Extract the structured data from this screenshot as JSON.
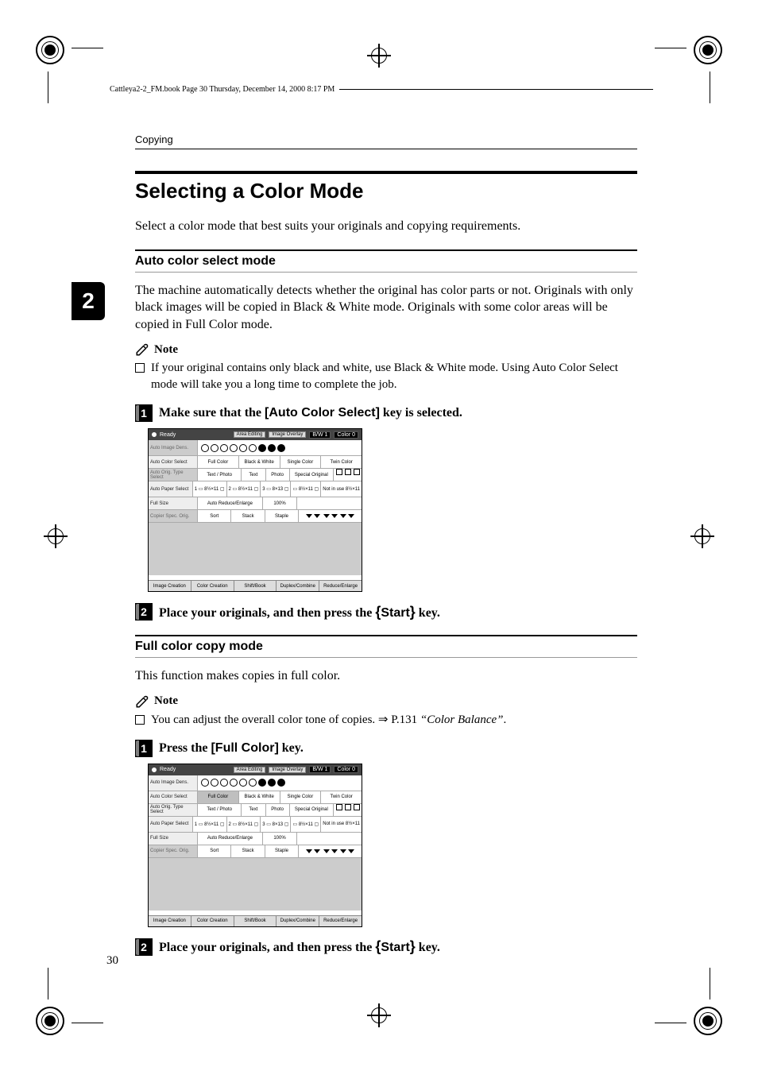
{
  "bookpath": "Cattleya2-2_FM.book  Page 30  Thursday, December 14, 2000  8:17 PM",
  "runhead": "Copying",
  "chapter_tab": "2",
  "page_number": "30",
  "h2": "Selecting a Color Mode",
  "intro": "Select a color mode that best suits your originals and copying requirements.",
  "sections": {
    "auto": {
      "h3": "Auto color select mode",
      "para": "The machine automatically detects whether the original has color parts or not. Originals with only black images will be copied in Black & White mode. Originals with some color areas will be copied in Full Color mode.",
      "note_label": "Note",
      "note_item": "If your original contains only black and white, use Black & White mode. Using Auto Color Select mode will take you a long time to complete the job.",
      "step1_pre": "Make sure that the ",
      "step1_key": "[Auto Color Select]",
      "step1_post": " key is selected.",
      "step2_pre": "Place your originals, and then press the ",
      "step2_key": "Start",
      "step2_post": " key."
    },
    "full": {
      "h3": "Full color copy mode",
      "para": "This function makes copies in full color.",
      "note_label": "Note",
      "note_item_pre": "You can adjust the overall color tone of copies. ⇒ P.131 ",
      "note_item_ref": "“Color Balance”",
      "note_item_post": ".",
      "step1_pre": "Press the ",
      "step1_key": "[Full Color]",
      "step1_post": " key.",
      "step2_pre": "Place your originals, and then press the ",
      "step2_key": "Start",
      "step2_post": " key."
    }
  },
  "panel": {
    "ready": "Ready",
    "top_chips": [
      "Area Editing",
      "Image Overlay"
    ],
    "count_bw": "B/W 1",
    "count_color": "Color 0",
    "rows": {
      "auto_image_dens": "Auto Image Dens.",
      "auto_color_select": "Auto Color Select",
      "color_cells": [
        "Full Color",
        "Black & White",
        "Single Color",
        "Twin Color"
      ],
      "auto_orig_type": "Auto Orig. Type Select",
      "orig_cells": [
        "Text / Photo",
        "Text",
        "Photo",
        "Special Original"
      ],
      "auto_paper": "Auto Paper Select",
      "paper_cells": [
        "1 ▭ 8½×11 ▢",
        "2 ▭ 8½×11 ▢",
        "3 ▭ 8×13 ▢",
        "▭ 8½×11 ▢",
        "Not in use 8½×11"
      ],
      "full_size": "Full Size",
      "auto_reduce": "Auto Reduce/Enlarge",
      "pct": "100%",
      "copier_spec": "Copier Spec. Orig.",
      "spec_cells": [
        "Sort",
        "Stack",
        "Staple"
      ]
    },
    "footer": [
      "Image Creation",
      "Color Creation",
      "Shift/Book",
      "Duplex/Combine",
      "Reduce/Enlarge"
    ]
  }
}
